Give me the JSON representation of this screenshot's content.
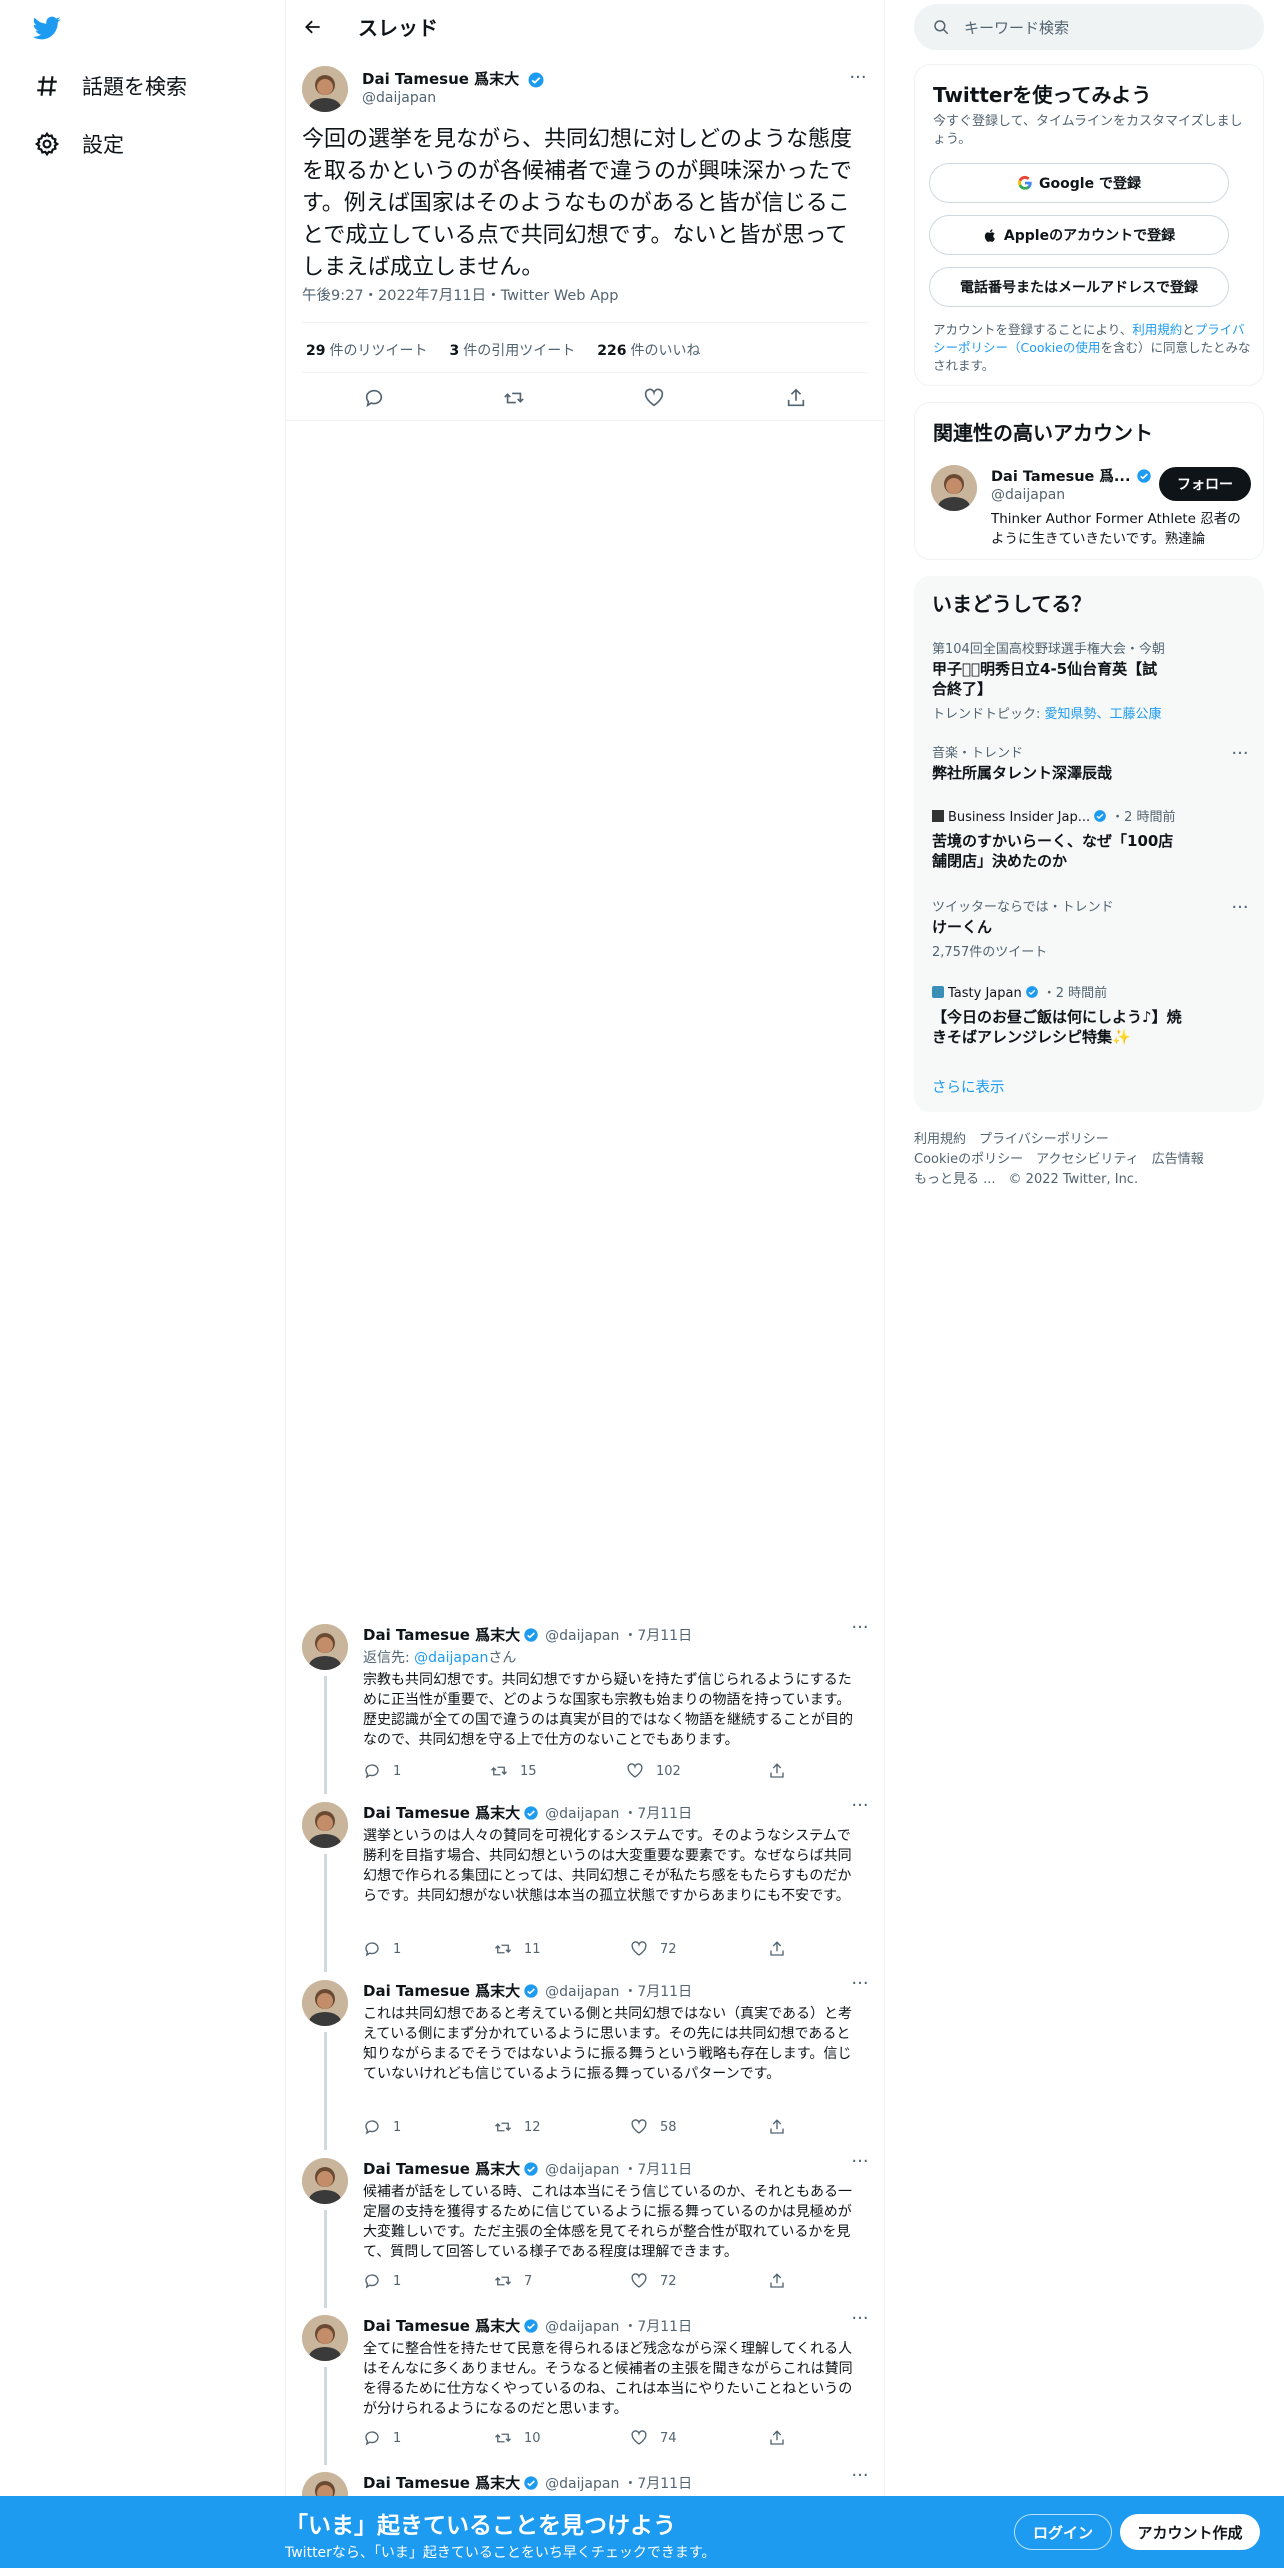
{
  "nav": {
    "explore_label": "話題を検索",
    "settings_label": "設定"
  },
  "header": {
    "title": "スレッド"
  },
  "tweet": {
    "author_name": "Dai Tamesue 爲末大",
    "handle": "@daijapan",
    "text": "今回の選挙を見ながら、共同幻想に対しどのような態度を取るかというのが各候補者で違うのが興味深かったです。例えば国家はそのようなものがあると皆が信じることで成立している点で共同幻想です。ないと皆が思ってしまえば成立しません。",
    "meta": "午後9:27・2022年7月11日・Twitter Web App",
    "retweets_count": "29",
    "retweets_label": "件のリツイート",
    "quotes_count": "3",
    "quotes_label": "件の引用ツイート",
    "likes_count": "226",
    "likes_label": "件のいいね"
  },
  "replies": [
    {
      "name": "Dai Tamesue 爲末大",
      "handle": "@daijapan",
      "date": "・7月11日",
      "reply_to_prefix": "返信先: ",
      "reply_to_handle": "@daijapan",
      "reply_to_suffix": "さん",
      "text": "宗教も共同幻想です。共同幻想ですから疑いを持たず信じられるようにするために正当性が重要で、どのような国家も宗教も始まりの物語を持っています。歴史認識が全ての国で違うのは真実が目的ではなく物語を継続することが目的なので、共同幻想を守る上で仕方のないことでもあります。",
      "replies": "1",
      "retweets": "15",
      "likes": "102"
    },
    {
      "name": "Dai Tamesue 爲末大",
      "handle": "@daijapan",
      "date": "・7月11日",
      "text": "選挙というのは人々の賛同を可視化するシステムです。そのようなシステムで勝利を目指す場合、共同幻想というのは大変重要な要素です。なぜならば共同幻想で作られる集団にとっては、共同幻想こそが私たち感をもたらすものだからです。共同幻想がない状態は本当の孤立状態ですからあまりにも不安です。",
      "replies": "1",
      "retweets": "11",
      "likes": "72"
    },
    {
      "name": "Dai Tamesue 爲末大",
      "handle": "@daijapan",
      "date": "・7月11日",
      "text": "これは共同幻想であると考えている側と共同幻想ではない（真実である）と考えている側にまず分かれているように思います。その先には共同幻想であると知りながらまるでそうではないように振る舞うという戦略も存在します。信じていないけれども信じているように振る舞っているパターンです。",
      "replies": "1",
      "retweets": "12",
      "likes": "58"
    },
    {
      "name": "Dai Tamesue 爲末大",
      "handle": "@daijapan",
      "date": "・7月11日",
      "text": "候補者が話をしている時、これは本当にそう信じているのか、それともある一定層の支持を獲得するために信じているように振る舞っているのかは見極めが大変難しいです。ただ主張の全体感を見てそれらが整合性が取れているかを見て、質問して回答している様子である程度は理解できます。",
      "replies": "1",
      "retweets": "7",
      "likes": "72"
    },
    {
      "name": "Dai Tamesue 爲末大",
      "handle": "@daijapan",
      "date": "・7月11日",
      "text": "全てに整合性を持たせて民意を得られるほど残念ながら深く理解してくれる人はそんなに多くありません。そうなると候補者の主張を聞きながらこれは賛同を得るために仕方なくやっているのね、これは本当にやりたいことねというのが分けられるようになるのだと思います。",
      "replies": "1",
      "retweets": "10",
      "likes": "74"
    },
    {
      "name": "Dai Tamesue 爲末大",
      "handle": "@daijapan",
      "date": "・7月11日"
    }
  ],
  "search": {
    "placeholder": "キーワード検索"
  },
  "signup": {
    "title": "Twitterを使ってみよう",
    "subtitle": "今すぐ登録して、タイムラインをカスタマイズしましょう。",
    "google_label": "Google で登録",
    "apple_label": "Appleのアカウントで登録",
    "phone_label": "電話番号またはメールアドレスで登録",
    "terms_prefix": "アカウントを登録することにより、",
    "terms_link": "利用規約",
    "terms_and": "と",
    "privacy_link": "プライバシーポリシー（Cookieの使用",
    "terms_suffix": "を含む）に同意したとみなされます。"
  },
  "related": {
    "title": "関連性の高いアカウント",
    "name": "Dai Tamesue 爲...",
    "handle": "@daijapan",
    "follow_label": "フォロー",
    "bio": "Thinker Author Former Athlete 忍者のように生きていきたいです。熟達論"
  },
  "trends": {
    "title": "いまどうしてる？",
    "items": [
      {
        "context": "第104回全国高校野球選手権大会・今朝",
        "title": "甲子園🏻明秀日立4-5仙台育英【試合終了】",
        "topic_prefix": "トレンドトピック: ",
        "topic": "愛知県勢、工藤公康"
      },
      {
        "context": "音楽・トレンド",
        "title": "弊社所属タレント深澤辰哉"
      },
      {
        "context": "Business Insider Jap...",
        "time": "・2 時間前",
        "title": "苦境のすかいらーく、なぜ「100店舗閉店」決めたのか"
      },
      {
        "context": "ツイッターならでは・トレンド",
        "title": "けーくん",
        "count": "2,757件のツイート"
      },
      {
        "context": "Tasty Japan",
        "time": "・2 時間前",
        "title": "【今日のお昼ご飯は何にしよう♪】焼きそばアレンジレシピ特集✨"
      }
    ],
    "more_label": "さらに表示"
  },
  "footer": {
    "terms": "利用規約",
    "privacy": "プライバシーポリシー",
    "cookie": "Cookieのポリシー",
    "accessibility": "アクセシビリティ",
    "ads": "広告情報",
    "more": "もっと見る ...",
    "copyright": "© 2022 Twitter, Inc."
  },
  "bottombar": {
    "title": "「いま」起きていることを見つけよう",
    "subtitle": "Twitterなら、「いま」起きていることをいち早くチェックできます。",
    "login_label": "ログイン",
    "signup_label": "アカウント作成"
  },
  "colors": {
    "accent": "#1d9bf0",
    "text": "#0f1419",
    "muted": "#536471",
    "border": "#eff3f4"
  }
}
